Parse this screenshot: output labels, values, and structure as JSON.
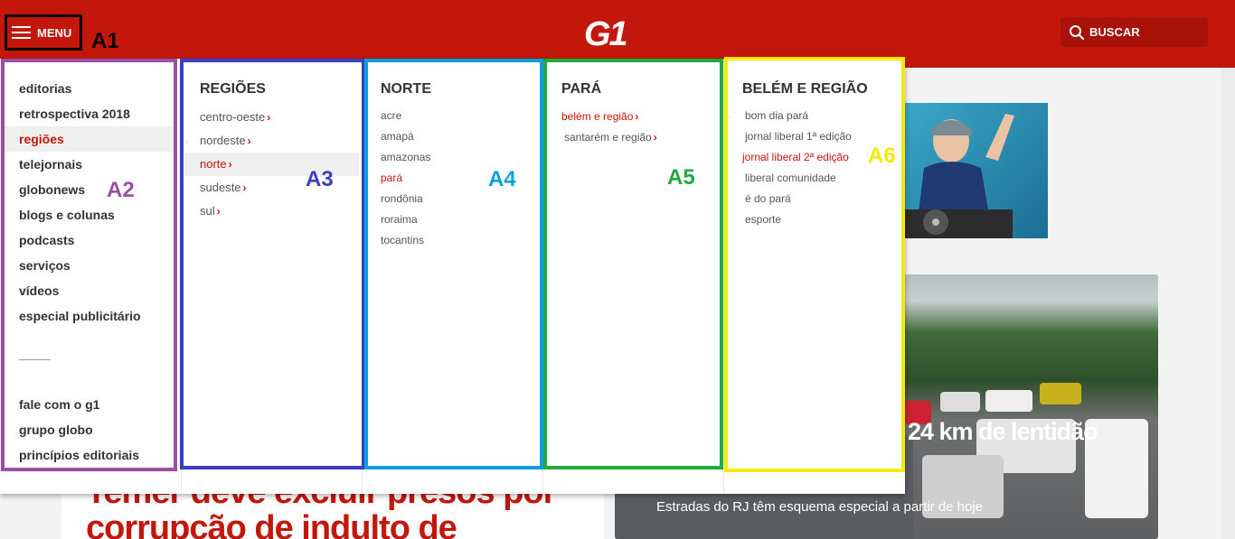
{
  "header": {
    "menu_label": "MENU",
    "logo": "G1",
    "search_label": "BUSCAR",
    "brand_color": "#c4170c"
  },
  "annotations": {
    "a1": "A1",
    "a2": "A2",
    "a3": "A3",
    "a4": "A4",
    "a5": "A5",
    "a6": "A6"
  },
  "menu": {
    "main_items": [
      "editorias",
      "retrospectiva 2018",
      "regiões",
      "telejornais",
      "globonews",
      "blogs e colunas",
      "podcasts",
      "serviços",
      "vídeos",
      "especial publicitário"
    ],
    "active_main": "regiões",
    "footer_items": [
      "fale com o g1",
      "grupo globo",
      "princípios editoriais"
    ],
    "regioes": {
      "title": "REGIÕES",
      "items": [
        "centro-oeste",
        "nordeste",
        "norte",
        "sudeste",
        "sul"
      ],
      "active": "norte"
    },
    "norte": {
      "title": "NORTE",
      "items": [
        "acre",
        "amapá",
        "amazonas",
        "pará",
        "rondônia",
        "roraima",
        "tocantins"
      ],
      "active": "pará"
    },
    "para": {
      "title": "PARÁ",
      "items": [
        "belém e região",
        "santarém e região"
      ],
      "active": "belém e região"
    },
    "belem": {
      "title": "BELÉM E REGIÃO",
      "items": [
        "bom dia pará",
        "jornal liberal 1ª edição",
        "jornal liberal 2ª edição",
        "liberal comunidade",
        "é do pará",
        "esporte"
      ],
      "active": "jornal liberal 2ª edição"
    },
    "chevron": "›"
  },
  "background": {
    "headline": "Temer deve excluir presos por corrupção de indulto de",
    "traffic_title": "24 km de lentidão",
    "traffic_caption": "Estradas do RJ têm esquema especial a partir de hoje"
  },
  "colors": {
    "a1": "#000000",
    "a2": "#9b4fa5",
    "a3": "#3b3fc4",
    "a4": "#0aa0e0",
    "a5": "#22ab3c",
    "a6": "#f5ea0a"
  }
}
